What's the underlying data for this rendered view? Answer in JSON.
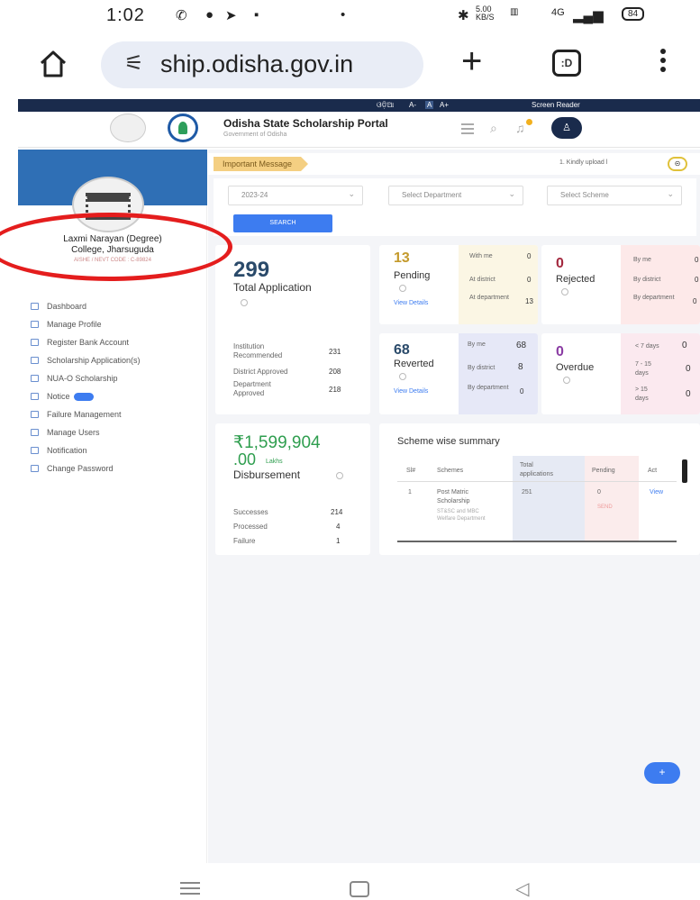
{
  "status": {
    "time": "1:02",
    "speed": "5.00 KB/S",
    "network": "4G",
    "battery": "84"
  },
  "browser": {
    "url": "ship.odisha.gov.in",
    "tabs_label": ":D"
  },
  "topstrip": {
    "lang": "ଓଡ଼ିଆ",
    "font_small": "A-",
    "font_normal": "A",
    "font_large": "A+",
    "screen_reader": "Screen Reader"
  },
  "header": {
    "title": "Odisha State Scholarship Portal",
    "subtitle": "Government of Odisha"
  },
  "sidebar": {
    "college_line1": "Laxmi Narayan (Degree)",
    "college_line2": "College, Jharsuguda",
    "code": "AISHE / NEVT CODE : C-89824",
    "items": [
      {
        "label": "Dashboard"
      },
      {
        "label": "Manage Profile"
      },
      {
        "label": "Register Bank Account"
      },
      {
        "label": "Scholarship Application(s)"
      },
      {
        "label": "NUA-O Scholarship"
      },
      {
        "label": "Notice"
      },
      {
        "label": "Failure Management"
      },
      {
        "label": "Manage Users"
      },
      {
        "label": "Notification"
      },
      {
        "label": "Change Password"
      }
    ]
  },
  "main": {
    "message_tag": "Important Message",
    "message_text": "1. Kindly upload l",
    "filters": {
      "year": "2023-24",
      "department": "Select Department",
      "scheme": "Select Scheme",
      "search_label": "SEARCH"
    },
    "total": {
      "value": "299",
      "label": "Total Application",
      "rows": [
        {
          "label": "Institution Recommended",
          "value": "231"
        },
        {
          "label": "District Approved",
          "value": "208"
        },
        {
          "label": "Department Approved",
          "value": "218"
        }
      ]
    },
    "pending": {
      "value": "13",
      "label": "Pending",
      "link": "View Details",
      "rows": [
        {
          "label": "With me",
          "value": "0"
        },
        {
          "label": "At district",
          "value": "0"
        },
        {
          "label": "At department",
          "value": "13"
        }
      ]
    },
    "rejected": {
      "value": "0",
      "label": "Rejected",
      "rows": [
        {
          "label": "By me",
          "value": "0"
        },
        {
          "label": "By district",
          "value": "0"
        },
        {
          "label": "By department",
          "value": "0"
        }
      ]
    },
    "reverted": {
      "value": "68",
      "label": "Reverted",
      "link": "View Details",
      "rows": [
        {
          "label": "By me",
          "value": "68"
        },
        {
          "label": "By district",
          "value": "8"
        },
        {
          "label": "By department",
          "value": "0"
        }
      ]
    },
    "overdue": {
      "value": "0",
      "label": "Overdue",
      "rows": [
        {
          "label": "< 7 days",
          "value": "0"
        },
        {
          "label": "7 - 15 days",
          "value": "0"
        },
        {
          "label": "> 15 days",
          "value": "0"
        }
      ]
    },
    "disbursement": {
      "amount": "₹1,599,904",
      "decimal": ".00",
      "unit": "Lakhs",
      "label": "Disbursement",
      "rows": [
        {
          "label": "Successes",
          "value": "214"
        },
        {
          "label": "Processed",
          "value": "4"
        },
        {
          "label": "Failure",
          "value": "1"
        }
      ]
    },
    "scheme_summary": {
      "title": "Scheme wise summary",
      "headers": [
        "Sl#",
        "Schemes",
        "Total applications",
        "Pending",
        "Act"
      ],
      "row": {
        "sl": "1",
        "scheme": "Post Matric Scholarship",
        "dept": "ST&SC and MBC Welfare Department",
        "total": "251",
        "pending": "0",
        "pending_sub": "SEND",
        "action": "View"
      }
    },
    "fab_label": "+"
  },
  "colors": {
    "primary": "#3d7cf0",
    "header_dark": "#1a2b4c",
    "annotation": "#e41d1d",
    "pending_bg": "#fbf6e4",
    "rejected_bg": "#fde9e9",
    "reverted_bg": "#e6e8f7",
    "overdue_bg": "#fbe9ef",
    "disbursement_green": "#2f9e4f"
  }
}
